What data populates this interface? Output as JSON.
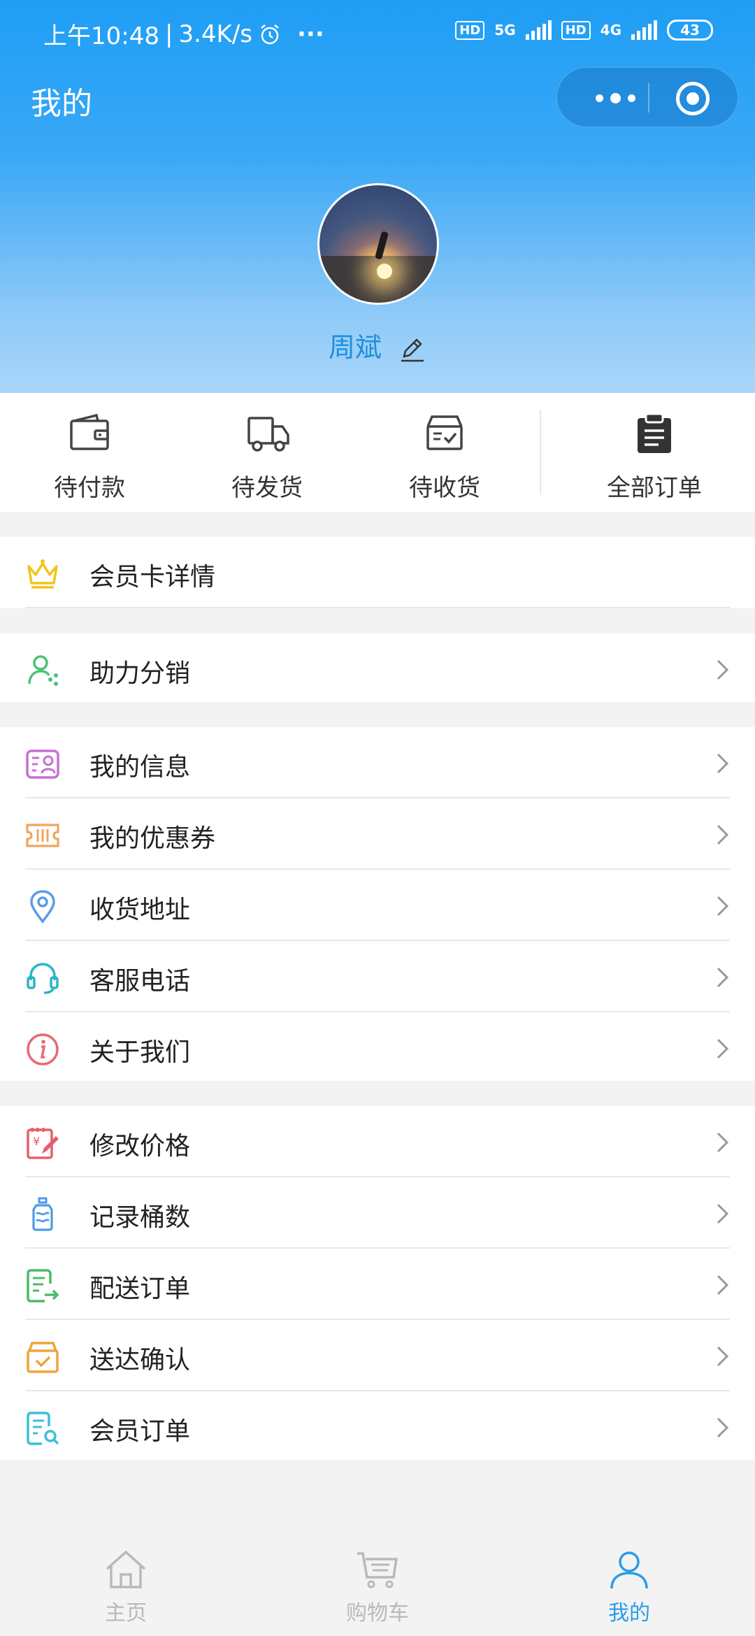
{
  "status_bar": {
    "time": "上午10:48",
    "speed": "3.4K/s",
    "more": "···",
    "hd1": "HD",
    "sig1": "5G",
    "hd2": "HD",
    "sig2": "4G",
    "battery": "43"
  },
  "nav": {
    "title": "我的"
  },
  "profile": {
    "name": "周斌"
  },
  "orders": [
    {
      "label": "待付款",
      "icon": "wallet-icon"
    },
    {
      "label": "待发货",
      "icon": "truck-icon"
    },
    {
      "label": "待收货",
      "icon": "inbox-icon"
    },
    {
      "label": "全部订单",
      "icon": "clipboard-icon"
    }
  ],
  "menu": {
    "membership": "会员卡详情",
    "distribution": "助力分销",
    "group2": [
      "我的信息",
      "我的优惠券",
      "收货地址",
      "客服电话",
      "关于我们"
    ],
    "group3": [
      "修改价格",
      "记录桶数",
      "配送订单",
      "送达确认",
      "会员订单"
    ]
  },
  "tabs": [
    {
      "label": "主页",
      "icon": "home-icon"
    },
    {
      "label": "购物车",
      "icon": "cart-icon"
    },
    {
      "label": "我的",
      "icon": "person-icon"
    }
  ],
  "colors": {
    "accent": "#2a9ce8",
    "header_top": "#1e9ef5",
    "header_bottom": "#a9d6fa"
  }
}
